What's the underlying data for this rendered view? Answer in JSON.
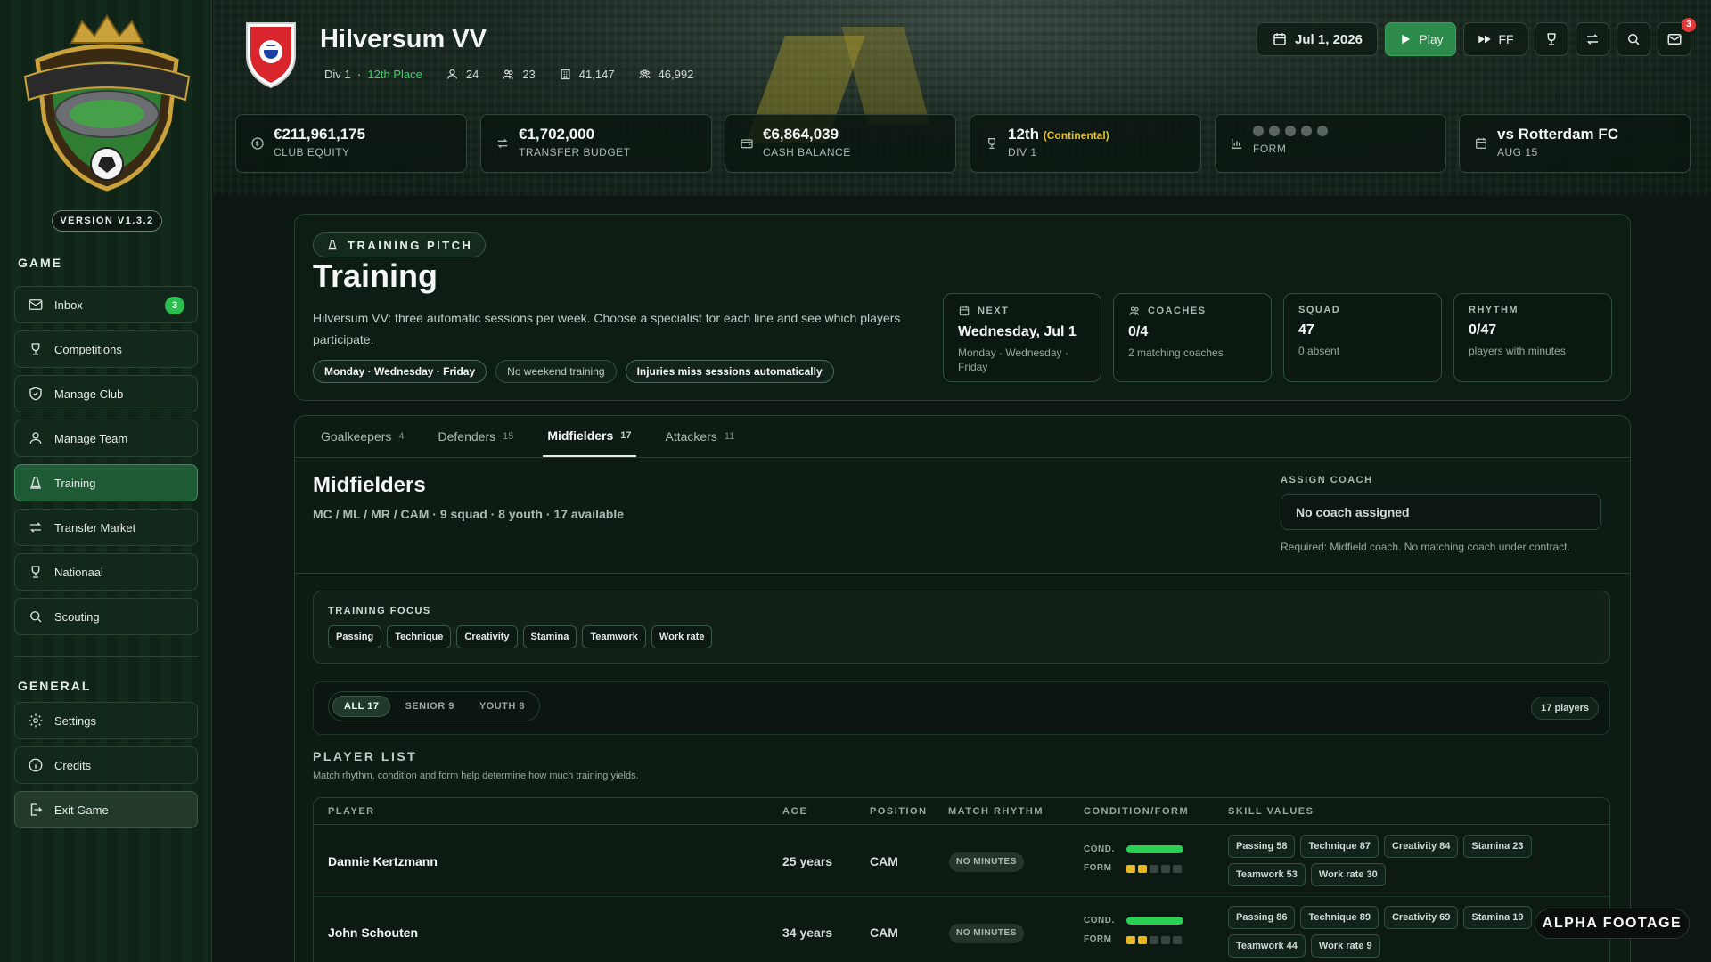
{
  "sidebar": {
    "version": "VERSION V1.3.2",
    "game_label": "GAME",
    "general_label": "GENERAL",
    "game_items": [
      {
        "label": "Inbox",
        "icon": "mail-icon",
        "badge": "3"
      },
      {
        "label": "Competitions",
        "icon": "trophy-icon"
      },
      {
        "label": "Manage Club",
        "icon": "shield-icon"
      },
      {
        "label": "Manage Team",
        "icon": "person-icon"
      },
      {
        "label": "Training",
        "icon": "cone-icon",
        "active": true
      },
      {
        "label": "Transfer Market",
        "icon": "transfer-icon"
      },
      {
        "label": "Nationaal",
        "icon": "trophy-icon"
      },
      {
        "label": "Scouting",
        "icon": "search-icon"
      }
    ],
    "general_items": [
      {
        "label": "Settings",
        "icon": "gear-icon"
      },
      {
        "label": "Credits",
        "icon": "info-icon"
      },
      {
        "label": "Exit Game",
        "icon": "exit-icon"
      }
    ]
  },
  "header": {
    "club_name": "Hilversum VV",
    "division": "Div 1",
    "place": "12th Place",
    "meta": [
      {
        "icon": "players-icon",
        "value": "24"
      },
      {
        "icon": "group-icon",
        "value": "23"
      },
      {
        "icon": "stadium-icon",
        "value": "41,147"
      },
      {
        "icon": "fans-icon",
        "value": "46,992"
      }
    ],
    "date": "Jul 1, 2026",
    "play_label": "Play",
    "ff_label": "FF",
    "mail_badge": "3",
    "stats": [
      {
        "value": "€211,961,175",
        "label": "CLUB EQUITY",
        "icon": "coin-icon"
      },
      {
        "value": "€1,702,000",
        "label": "TRANSFER BUDGET",
        "icon": "transfer-icon"
      },
      {
        "value": "€6,864,039",
        "label": "CASH BALANCE",
        "icon": "wallet-icon"
      },
      {
        "value": "12th",
        "extra": "(Continental)",
        "label": "DIV 1",
        "icon": "trophy-icon"
      },
      {
        "label": "FORM",
        "icon": "chart-icon"
      },
      {
        "value": "vs Rotterdam FC",
        "label": "AUG 15",
        "icon": "calendar-icon"
      }
    ],
    "colors": {
      "accent_green": "#2c8a4a",
      "continental": "#e3c12a",
      "notification": "#e23a3a"
    }
  },
  "training": {
    "pill": "TRAINING PITCH",
    "title": "Training",
    "description": "Hilversum VV: three automatic sessions per week. Choose a specialist for each line and see which players participate.",
    "tags": [
      "Monday · Wednesday · Friday",
      "No weekend training",
      "Injuries miss sessions automatically"
    ],
    "cards": [
      {
        "label": "NEXT",
        "value": "Wednesday, Jul 1",
        "sub": "Monday · Wednesday · Friday",
        "icon": "calendar-icon"
      },
      {
        "label": "COACHES",
        "value": "0/4",
        "sub": "2 matching coaches",
        "icon": "people-icon"
      },
      {
        "label": "SQUAD",
        "value": "47",
        "sub": "0 absent"
      },
      {
        "label": "RHYTHM",
        "value": "0/47",
        "sub": "players with minutes"
      }
    ]
  },
  "lines": {
    "tabs": [
      {
        "label": "Goalkeepers",
        "count": "4"
      },
      {
        "label": "Defenders",
        "count": "15"
      },
      {
        "label": "Midfielders",
        "count": "17",
        "active": true
      },
      {
        "label": "Attackers",
        "count": "11"
      }
    ],
    "title": "Midfielders",
    "meta": "MC / ML / MR / CAM · 9 squad · 8 youth · 17 available",
    "assign_label": "ASSIGN COACH",
    "coach_value": "No coach assigned",
    "coach_req": "Required: Midfield coach. No matching coach under contract.",
    "focus_label": "TRAINING FOCUS",
    "focus": [
      "Passing",
      "Technique",
      "Creativity",
      "Stamina",
      "Teamwork",
      "Work rate"
    ],
    "filters": [
      "ALL 17",
      "SENIOR 9",
      "YOUTH 8"
    ],
    "players_count": "17 players",
    "list_title": "PLAYER LIST",
    "list_sub": "Match rhythm, condition and form help determine how much training yields.",
    "columns": [
      "PLAYER",
      "AGE",
      "POSITION",
      "MATCH RHYTHM",
      "CONDITION/FORM",
      "SKILL VALUES"
    ],
    "cond_label": "COND.",
    "form_label": "FORM",
    "players": [
      {
        "name": "Dannie Kertzmann",
        "age": "25 years",
        "position": "CAM",
        "rhythm": "NO MINUTES",
        "condition": 1.0,
        "form_filled": 2,
        "skills": [
          "Passing 58",
          "Technique 87",
          "Creativity 84",
          "Stamina 23",
          "Teamwork 53",
          "Work rate 30"
        ]
      },
      {
        "name": "John Schouten",
        "age": "34 years",
        "position": "CAM",
        "rhythm": "NO MINUTES",
        "condition": 1.0,
        "form_filled": 2,
        "skills": [
          "Passing 86",
          "Technique 89",
          "Creativity 69",
          "Stamina 19",
          "Teamwork 44",
          "Work rate 9"
        ]
      }
    ]
  },
  "watermark": "ALPHA FOOTAGE"
}
